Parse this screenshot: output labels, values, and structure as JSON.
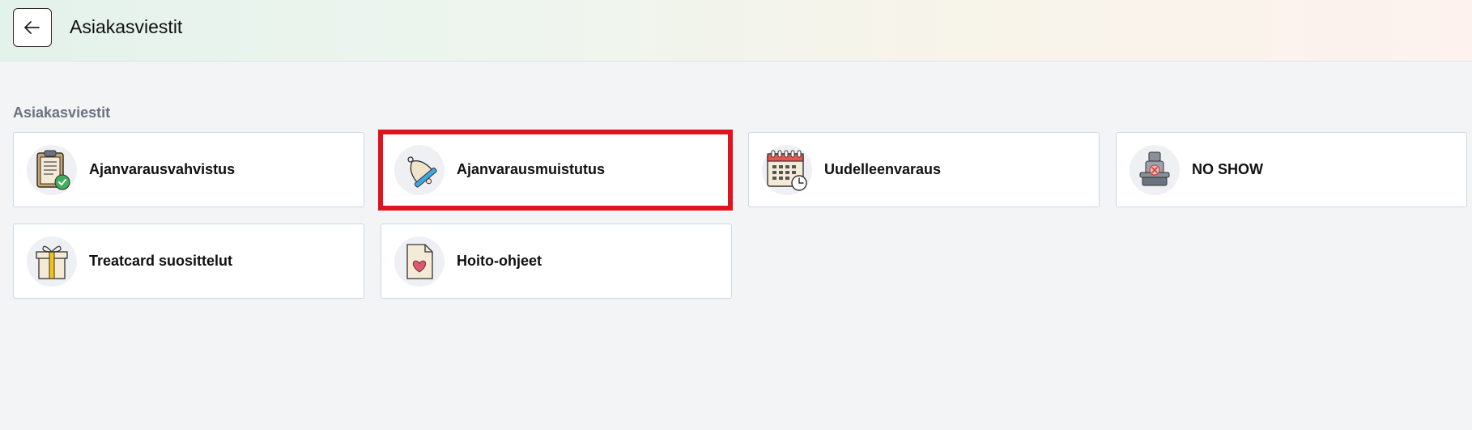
{
  "header": {
    "title": "Asiakasviestit",
    "back_icon": "arrow-left-icon"
  },
  "section": {
    "label": "Asiakasviestit"
  },
  "cards": [
    {
      "label": "Ajanvarausvahvistus",
      "icon": "clipboard-check-icon"
    },
    {
      "label": "Ajanvarausmuistutus",
      "icon": "bell-icon",
      "highlighted": true
    },
    {
      "label": "Uudelleenvaraus",
      "icon": "calendar-clock-icon"
    },
    {
      "label": "NO SHOW",
      "icon": "empty-chair-icon"
    },
    {
      "label": "Treatcard suosittelut",
      "icon": "gift-box-icon"
    },
    {
      "label": "Hoito-ohjeet",
      "icon": "document-heart-icon"
    }
  ],
  "colors": {
    "highlight": "#e0141e",
    "card_border": "#c9d9ea",
    "background": "#f3f4f6"
  }
}
